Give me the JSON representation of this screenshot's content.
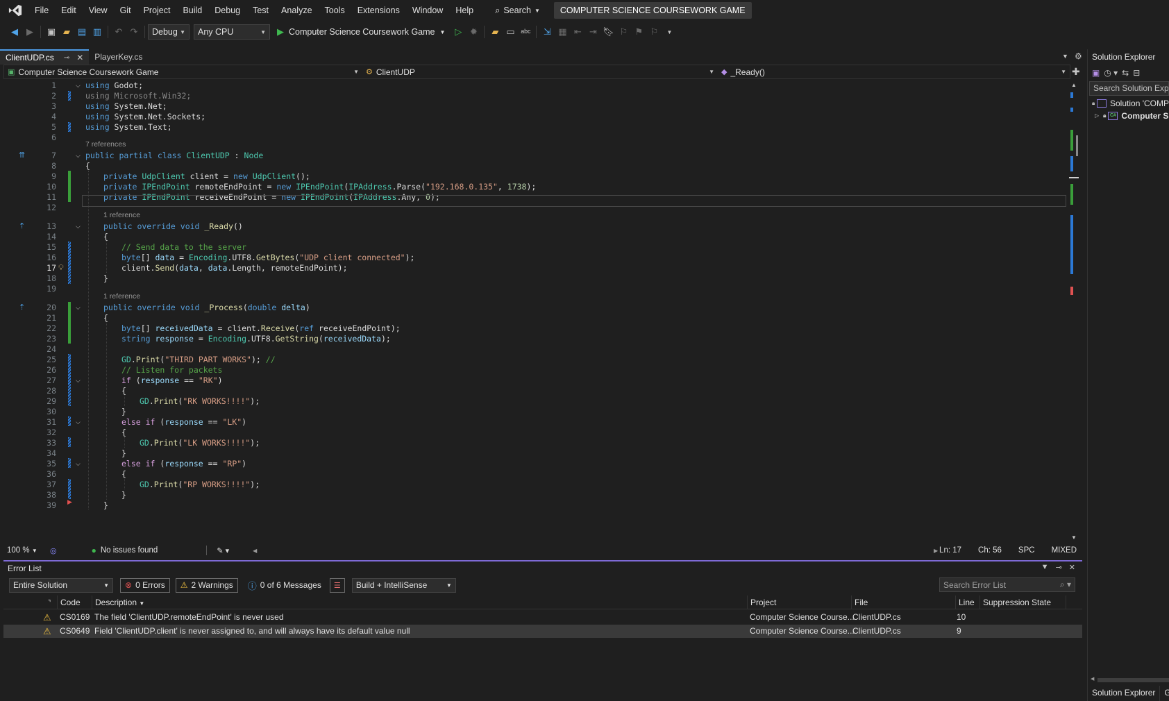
{
  "menubar": {
    "items": [
      "File",
      "Edit",
      "View",
      "Git",
      "Project",
      "Build",
      "Debug",
      "Test",
      "Analyze",
      "Tools",
      "Extensions",
      "Window",
      "Help"
    ],
    "search_label": "Search",
    "title": "COMPUTER SCIENCE COURSEWORK GAME"
  },
  "toolbar": {
    "configuration": "Debug",
    "platform": "Any CPU",
    "run_target": "Computer Science Coursework Game"
  },
  "tabs": [
    {
      "label": "ClientUDP.cs",
      "active": true
    },
    {
      "label": "PlayerKey.cs",
      "active": false
    }
  ],
  "navbar": {
    "project": "Computer Science Coursework Game",
    "class": "ClientUDP",
    "member": "_Ready()"
  },
  "editor": {
    "line_numbers": [
      "1",
      "2",
      "3",
      "4",
      "5",
      "6",
      "7",
      "8",
      "9",
      "10",
      "11",
      "12",
      "13",
      "14",
      "15",
      "16",
      "17",
      "18",
      "19",
      "20",
      "21",
      "22",
      "23",
      "24",
      "25",
      "26",
      "27",
      "28",
      "29",
      "30",
      "31",
      "32",
      "33",
      "34",
      "35",
      "36",
      "37",
      "38",
      "39"
    ],
    "current_line": "17",
    "ref_7": "7 references",
    "ref_13": "1 reference",
    "ref_20": "1 reference",
    "code": {
      "l1": [
        "using",
        " Godot;"
      ],
      "l2": [
        "using",
        " Microsoft.Win32;"
      ],
      "l3": [
        "using",
        " System.Net;"
      ],
      "l4": [
        "using",
        " System.Net.Sockets;"
      ],
      "l5": [
        "using",
        " System.Text;"
      ],
      "l7": [
        "public partial class",
        "ClientUDP",
        ":",
        "Node"
      ],
      "l8": "{",
      "l9": [
        "private",
        "UdpClient",
        "client",
        "=",
        "new",
        "UdpClient",
        "();"
      ],
      "l10": [
        "private",
        "IPEndPoint",
        "remoteEndPoint",
        "=",
        "new",
        "IPEndPoint",
        "(",
        "IPAddress",
        ".Parse(",
        "\"192.168.0.135\"",
        ",",
        "1738",
        ");"
      ],
      "l11": [
        "private",
        "IPEndPoint",
        "receiveEndPoint",
        "=",
        "new",
        "IPEndPoint",
        "(",
        "IPAddress",
        ".Any,",
        "0",
        ");"
      ],
      "l13": [
        "public override void",
        "_Ready",
        "()"
      ],
      "l14": "{",
      "l15": "// Send data to the server",
      "l16": [
        "byte",
        "[]",
        "data",
        "=",
        "Encoding",
        ".UTF8.",
        "GetBytes",
        "(",
        "\"UDP client connected\"",
        ");"
      ],
      "l17": [
        "client",
        ".",
        "Send",
        "(",
        "data",
        ",",
        "data",
        ".Length,",
        "remoteEndPoint",
        ");"
      ],
      "l18": "}",
      "l20": [
        "public override void",
        "_Process",
        "(",
        "double",
        "delta",
        ")"
      ],
      "l21": "{",
      "l22": [
        "byte",
        "[]",
        "receivedData",
        "=",
        "client",
        ".",
        "Receive",
        "(",
        "ref",
        "receiveEndPoint",
        ");"
      ],
      "l23": [
        "string",
        "response",
        "=",
        "Encoding",
        ".UTF8.",
        "GetString",
        "(",
        "receivedData",
        ");"
      ],
      "l25": [
        "GD",
        ".",
        "Print",
        "(",
        "\"THIRD PART WORKS\"",
        ");",
        "//"
      ],
      "l26": "// Listen for packets",
      "l27": [
        "if",
        "(",
        "response",
        "==",
        "\"RK\"",
        ")"
      ],
      "l28": "{",
      "l29": [
        "GD",
        ".",
        "Print",
        "(",
        "\"RK WORKS!!!!\"",
        ");"
      ],
      "l30": "}",
      "l31": [
        "else if",
        "(",
        "response",
        "==",
        "\"LK\"",
        ")"
      ],
      "l32": "{",
      "l33": [
        "GD",
        ".",
        "Print",
        "(",
        "\"LK WORKS!!!!\"",
        ");"
      ],
      "l34": "}",
      "l35": [
        "else if",
        "(",
        "response",
        "==",
        "\"RP\"",
        ")"
      ],
      "l36": "{",
      "l37": [
        "GD",
        ".",
        "Print",
        "(",
        "\"RP WORKS!!!!\"",
        ");"
      ],
      "l38": "}",
      "l39": "}"
    }
  },
  "status": {
    "zoom": "100 %",
    "issues": "No issues found",
    "line": "Ln: 17",
    "col": "Ch: 56",
    "whitespace": "SPC",
    "line_endings": "MIXED"
  },
  "error_list": {
    "title": "Error List",
    "scope": "Entire Solution",
    "errors": "0 Errors",
    "warnings": "2 Warnings",
    "messages": "0 of 6 Messages",
    "build_filter": "Build + IntelliSense",
    "search_placeholder": "Search Error List",
    "columns": {
      "code": "Code",
      "description": "Description",
      "project": "Project",
      "file": "File",
      "line": "Line",
      "suppression": "Suppression State"
    },
    "rows": [
      {
        "code": "CS0169",
        "description": "The field 'ClientUDP.remoteEndPoint' is never used",
        "project": "Computer Science Course...",
        "file": "ClientUDP.cs",
        "line": "10"
      },
      {
        "code": "CS0649",
        "description": "Field 'ClientUDP.client' is never assigned to, and will always have its default value null",
        "project": "Computer Science Course...",
        "file": "ClientUDP.cs",
        "line": "9"
      }
    ]
  },
  "solution_explorer": {
    "title": "Solution Explorer",
    "search_placeholder": "Search Solution Explo",
    "solution_node": "Solution 'COMP",
    "project_node": "Computer S",
    "bottom_tabs": [
      "Solution Explorer",
      "Gi"
    ]
  },
  "colors": {
    "accent": "#4d9be6",
    "error_list_border": "#7e6ad6",
    "warning": "#f0c040"
  }
}
